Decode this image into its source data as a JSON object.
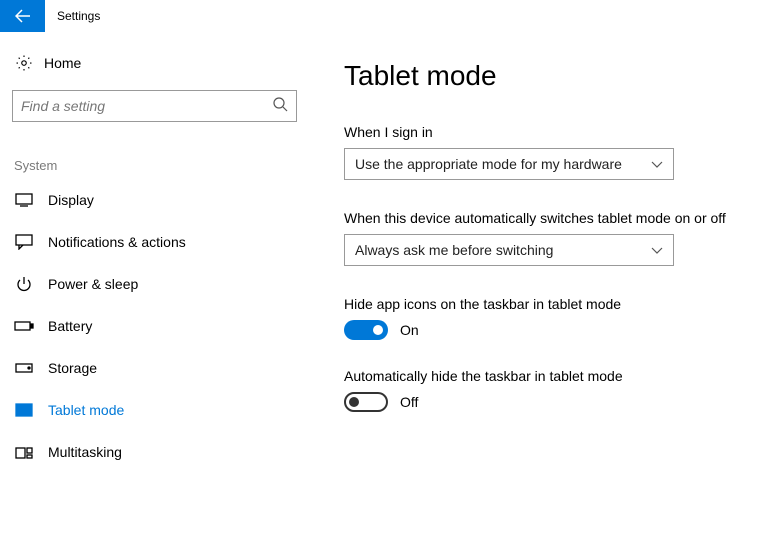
{
  "window": {
    "title": "Settings"
  },
  "sidebar": {
    "home": "Home",
    "search_placeholder": "Find a setting",
    "group": "System",
    "items": [
      {
        "label": "Display"
      },
      {
        "label": "Notifications & actions"
      },
      {
        "label": "Power & sleep"
      },
      {
        "label": "Battery"
      },
      {
        "label": "Storage"
      },
      {
        "label": "Tablet mode"
      },
      {
        "label": "Multitasking"
      }
    ]
  },
  "main": {
    "title": "Tablet mode",
    "signin_label": "When I sign in",
    "signin_value": "Use the appropriate mode for my hardware",
    "switch_label": "When this device automatically switches tablet mode on or off",
    "switch_value": "Always ask me before switching",
    "hide_icons_label": "Hide app icons on the taskbar in tablet mode",
    "hide_icons_state": "On",
    "hide_taskbar_label": "Automatically hide the taskbar in tablet mode",
    "hide_taskbar_state": "Off"
  }
}
